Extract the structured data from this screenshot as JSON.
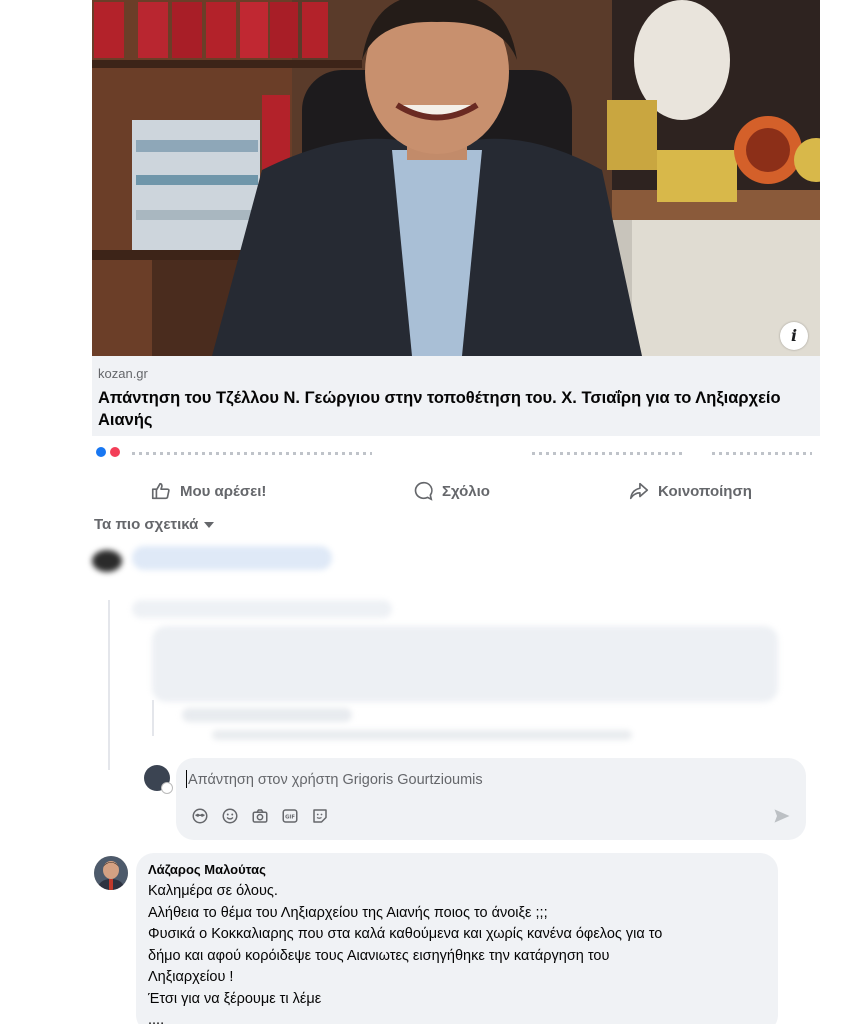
{
  "link_preview": {
    "domain": "kozan.gr",
    "title": "Απάντηση του Τζέλλου Ν. Γεώργιου στην τοποθέτηση του. Χ. Τσιαΐρη για το Ληξιαρχείο Αιανής",
    "info_icon": "info-icon"
  },
  "actions": {
    "like": "Μου αρέσει!",
    "comment": "Σχόλιο",
    "share": "Κοινοποίηση"
  },
  "sort": {
    "label": "Τα πιο σχετικά"
  },
  "reply": {
    "placeholder": "Απάντηση στον χρήστη Grigoris Gourtzioumis",
    "tools": [
      "avatar-sticker-icon",
      "emoji-icon",
      "camera-icon",
      "gif-icon",
      "sticker-icon"
    ],
    "send_icon": "send-icon"
  },
  "comment": {
    "author": "Λάζαρος Μαλούτας",
    "lines": [
      "Καλημέρα σε όλους.",
      "Αλήθεια το θέμα του Ληξιαρχείου της Αιανής ποιος το άνοιξε ;;;",
      "Φυσικά ο Κοκκαλιαρης που στα καλά καθούμενα και χωρίς κανένα όφελος για το",
      "δήμο και αφού κορόιδεψε τους Αιανιωτες εισηγήθηκε την κατάργηση του",
      "Ληξιαρχείου !",
      "Έτσι για να ξέρουμε τι λέμε",
      "...."
    ]
  },
  "colors": {
    "secondary_text": "#65676b",
    "surface": "#f0f2f5",
    "primary_text": "#050505"
  }
}
